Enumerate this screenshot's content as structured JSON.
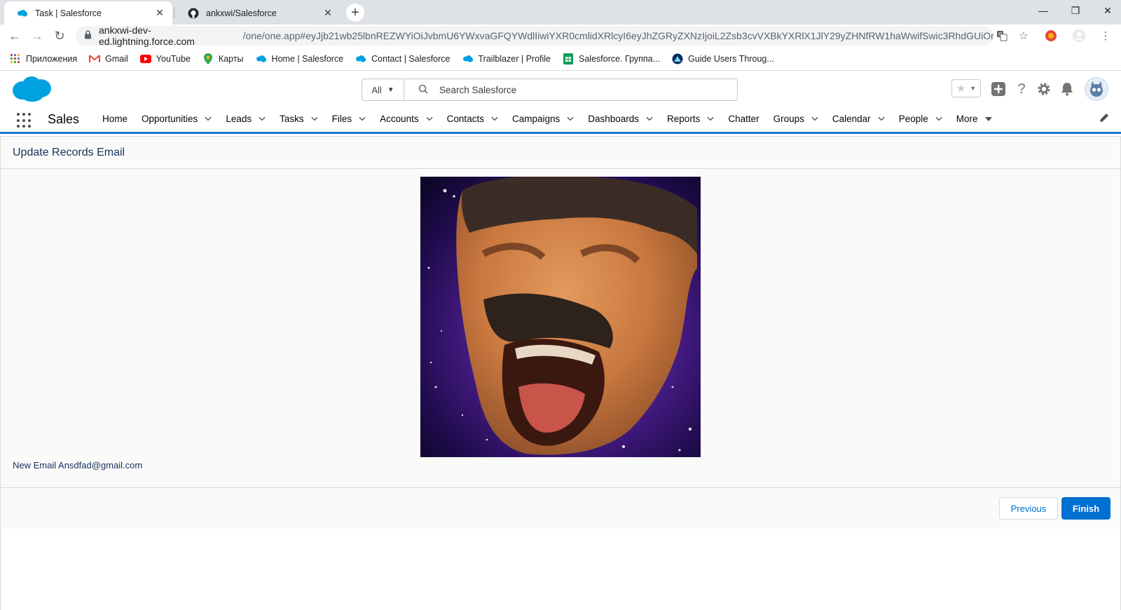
{
  "browser": {
    "tabs": [
      {
        "title": "Task | Salesforce",
        "favicon": "salesforce-cloud-icon",
        "active": true
      },
      {
        "title": "ankxwi/Salesforce",
        "favicon": "github-icon",
        "active": false
      }
    ],
    "url_host": "ankxwi-dev-ed.lightning.force.com",
    "url_path": "/one/one.app#eyJjb21wb25lbnREZWYiOiJvbmU6YWxvaGFQYWdlIiwiYXR0cmlidXRlcyI6eyJhZGRyZXNzIjoiL2Zsb3cvVXBkYXRlX1JlY29yZHNfRW1haWwifSwic3RhdGUiOnt9f...",
    "bookmarks": [
      {
        "label": "Приложения",
        "icon": "apps-grid-icon"
      },
      {
        "label": "Gmail",
        "icon": "gmail-icon"
      },
      {
        "label": "YouTube",
        "icon": "youtube-icon"
      },
      {
        "label": "Карты",
        "icon": "maps-icon"
      },
      {
        "label": "Home | Salesforce",
        "icon": "salesforce-cloud-icon"
      },
      {
        "label": "Contact | Salesforce",
        "icon": "salesforce-cloud-icon"
      },
      {
        "label": "Trailblazer | Profile",
        "icon": "salesforce-cloud-icon"
      },
      {
        "label": "Salesforce. Группа...",
        "icon": "sheets-icon"
      },
      {
        "label": "Guide Users Throug...",
        "icon": "trailhead-icon"
      }
    ]
  },
  "header": {
    "search_scope": "All",
    "search_placeholder": "Search Salesforce"
  },
  "nav": {
    "app_name": "Sales",
    "items": [
      {
        "label": "Home",
        "has_menu": false
      },
      {
        "label": "Opportunities",
        "has_menu": true
      },
      {
        "label": "Leads",
        "has_menu": true
      },
      {
        "label": "Tasks",
        "has_menu": true
      },
      {
        "label": "Files",
        "has_menu": true
      },
      {
        "label": "Accounts",
        "has_menu": true
      },
      {
        "label": "Contacts",
        "has_menu": true
      },
      {
        "label": "Campaigns",
        "has_menu": true
      },
      {
        "label": "Dashboards",
        "has_menu": true
      },
      {
        "label": "Reports",
        "has_menu": true
      },
      {
        "label": "Chatter",
        "has_menu": false
      },
      {
        "label": "Groups",
        "has_menu": true
      },
      {
        "label": "Calendar",
        "has_menu": true
      },
      {
        "label": "People",
        "has_menu": true
      },
      {
        "label": "More",
        "has_menu": true
      }
    ]
  },
  "flow": {
    "title": "Update Records Email",
    "email_text": "New Email Ansdfad@gmail.com",
    "previous_label": "Previous",
    "finish_label": "Finish"
  },
  "colors": {
    "brand_blue": "#0070d2",
    "nav_underline": "#1b75d0",
    "salesforce_cloud": "#00a1e0"
  }
}
